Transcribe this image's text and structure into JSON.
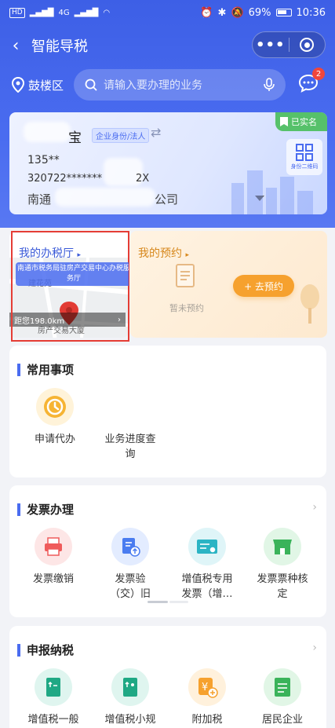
{
  "status_bar": {
    "left_chips": [
      "HD",
      "4G"
    ],
    "time": "10:36",
    "battery": "69%"
  },
  "nav": {
    "back_icon": "chevron-left-icon",
    "title": "智能导税",
    "more_icon": "more-dots-icon",
    "close_icon": "target-circle-icon"
  },
  "search": {
    "location_icon": "map-pin-icon",
    "location": "鼓楼区",
    "placeholder": "请输入要办理的业务",
    "mic_icon": "microphone-icon",
    "msg_icon": "message-bubble-icon",
    "badge_count": "2"
  },
  "identity_card": {
    "verified_label": "已实名",
    "name_suffix": "宝",
    "role_tag": "企业身份/法人",
    "swap_icon": "swap-arrows-icon",
    "phone": "135**",
    "id_number": "320722*******",
    "id_suffix": "2X",
    "company_prefix": "南通",
    "company_suffix": "公司",
    "qr_label": "身份二维码",
    "qr_icon": "qr-code-icon"
  },
  "tax_hall": {
    "title": "我的办税厅",
    "subtitle": "南通市税务局驻房产交易中心办税服务厅",
    "map_text": "建花苑",
    "map_text2": "房产交易大厦",
    "distance": "距您198.0km",
    "arrow": "›"
  },
  "appointment": {
    "title": "我的预约",
    "empty_text": "暂未预约",
    "button": "+ 去预约"
  },
  "common": {
    "title": "常用事项",
    "items": [
      {
        "label": "申请代办",
        "icon": "clock-icon",
        "color": "#f6b434"
      },
      {
        "label": "业务进度查询",
        "icon": "progress-icon"
      }
    ]
  },
  "invoice": {
    "title": "发票办理",
    "items": [
      {
        "label": "发票缴销",
        "icon": "printer-icon",
        "bg": "#fde6e6",
        "fg": "#ef5b5b"
      },
      {
        "label": "发票验（交）旧",
        "icon": "invoice-upload-icon",
        "bg": "#e3ecff",
        "fg": "#4a7cf0"
      },
      {
        "label": "增值税专用发票（增…",
        "icon": "vat-invoice-icon",
        "bg": "#dff5f8",
        "fg": "#2bb4c4"
      },
      {
        "label": "发票票种核定",
        "icon": "shop-icon",
        "bg": "#e1f6e6",
        "fg": "#3ab35a"
      }
    ]
  },
  "declare": {
    "title": "申报纳税",
    "items": [
      {
        "label": "增值税一般",
        "icon": "declare-general-icon",
        "bg": "#dff5ef",
        "fg": "#1fa884"
      },
      {
        "label": "增值税小规",
        "icon": "declare-small-icon",
        "bg": "#dff5ef",
        "fg": "#1fa884"
      },
      {
        "label": "附加税",
        "icon": "surtax-icon",
        "bg": "#fff1dc",
        "fg": "#f6a12e"
      },
      {
        "label": "居民企业",
        "icon": "enterprise-doc-icon",
        "bg": "#e1f6e6",
        "fg": "#3ab35a"
      }
    ]
  }
}
